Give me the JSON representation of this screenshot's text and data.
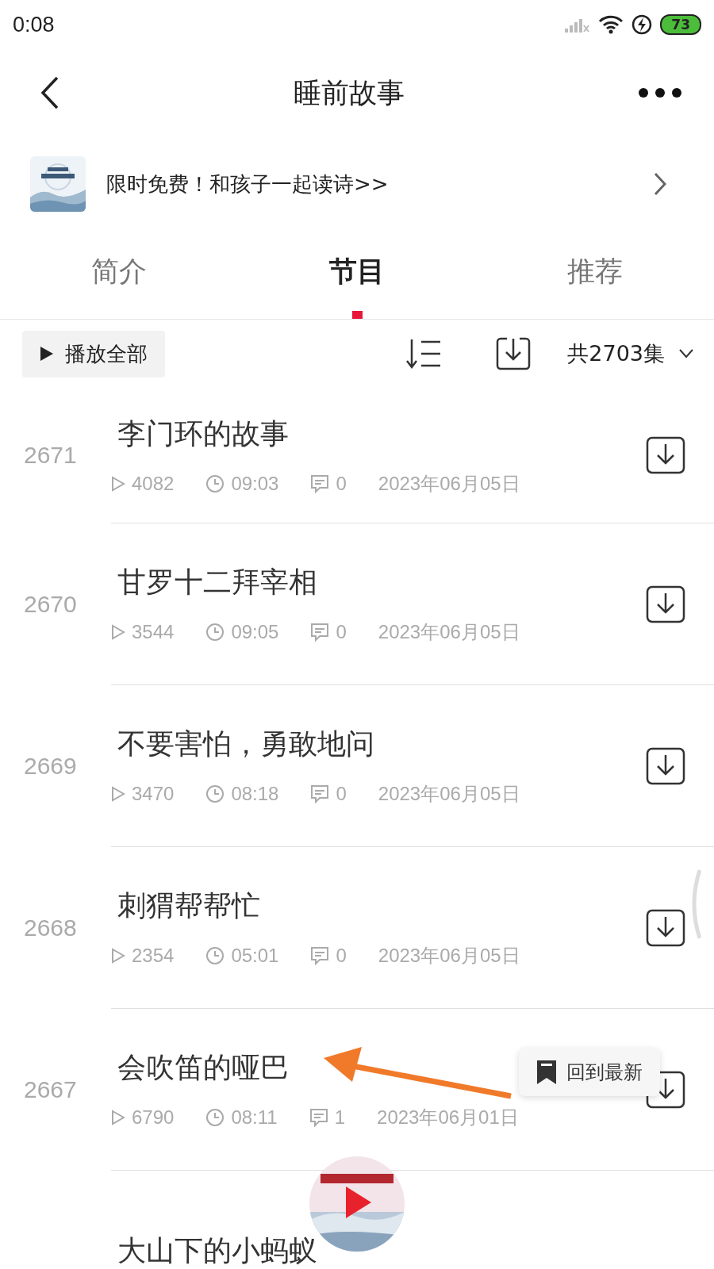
{
  "status_bar": {
    "time": "0:08",
    "battery": "73"
  },
  "header": {
    "title": "睡前故事"
  },
  "banner": {
    "text": "限时免费！和孩子一起读诗>>"
  },
  "tabs": [
    {
      "label": "简介",
      "selected": false
    },
    {
      "label": "节目",
      "selected": true
    },
    {
      "label": "推荐",
      "selected": false
    }
  ],
  "toolbar": {
    "play_all": "播放全部",
    "count": "共2703集"
  },
  "episodes": [
    {
      "number": "2671",
      "title": "李门环的故事",
      "plays": "4082",
      "duration": "09:03",
      "comments": "0",
      "date": "2023年06月05日"
    },
    {
      "number": "2670",
      "title": "甘罗十二拜宰相",
      "plays": "3544",
      "duration": "09:05",
      "comments": "0",
      "date": "2023年06月05日"
    },
    {
      "number": "2669",
      "title": "不要害怕，勇敢地问",
      "plays": "3470",
      "duration": "08:18",
      "comments": "0",
      "date": "2023年06月05日"
    },
    {
      "number": "2668",
      "title": "刺猬帮帮忙",
      "plays": "2354",
      "duration": "05:01",
      "comments": "0",
      "date": "2023年06月05日"
    },
    {
      "number": "2667",
      "title": "会吹笛的哑巴",
      "plays": "6790",
      "duration": "08:11",
      "comments": "1",
      "date": "2023年06月01日"
    },
    {
      "title": "大山下的小蚂蚁"
    }
  ],
  "float_button": {
    "label": "回到最新"
  }
}
